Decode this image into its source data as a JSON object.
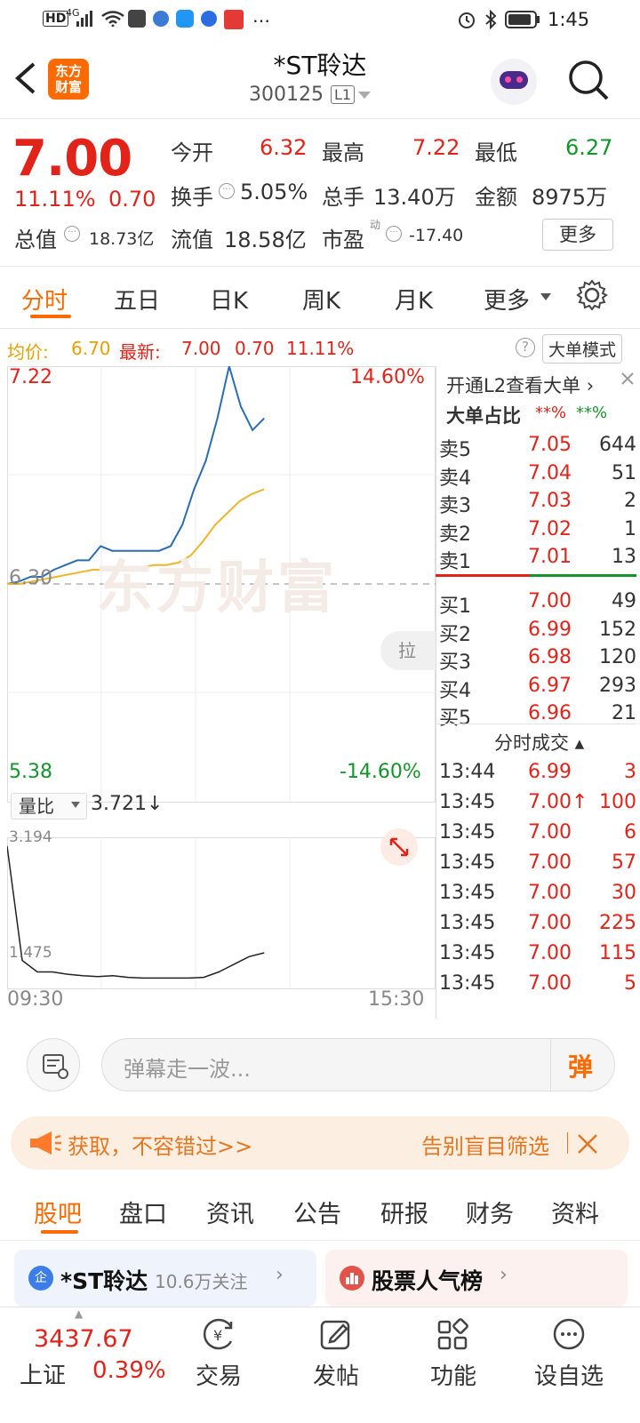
{
  "status": {
    "time": "1:45",
    "net": "4G"
  },
  "header": {
    "logo": "东方\n财富",
    "title": "*ST聆达",
    "code": "300125",
    "level": "L1"
  },
  "quote": {
    "price": "7.00",
    "pct": "11.11%",
    "chg": "0.70",
    "open_label": "今开",
    "open": "6.32",
    "high_label": "最高",
    "high": "7.22",
    "low_label": "最低",
    "low": "6.27",
    "turnover_label": "换手",
    "turnover": "5.05%",
    "vol_label": "总手",
    "vol": "13.40万",
    "amount_label": "金额",
    "amount": "8975万",
    "mcap_label": "总值",
    "mcap": "18.73亿",
    "float_label": "流值",
    "float": "18.58亿",
    "pe_label": "市盈",
    "pe_sup": "动",
    "pe": "-17.40",
    "more_btn": "更多"
  },
  "tabs": [
    "分时",
    "五日",
    "日K",
    "周K",
    "月K",
    "更多"
  ],
  "infobar": {
    "avg_label": "均价:",
    "avg": "6.70",
    "latest_label": "最新:",
    "latest": "7.00",
    "chg": "0.70",
    "pct": "11.11%",
    "mode_btn": "大单模式"
  },
  "chart": {
    "y_top": "7.22",
    "y_top_pct": "14.60%",
    "y_mid": "6.30",
    "y_bottom": "5.38",
    "y_bottom_pct": "-14.60%",
    "pull_label": "拉",
    "watermark": "东方财富",
    "vr_label": "量比",
    "vr_value": "3.721↓",
    "vr_top": "3.194",
    "vr_bottom": "1.475",
    "time_start": "09:30",
    "time_end": "15:30"
  },
  "chart_data": {
    "type": "line",
    "x_range": [
      "09:30",
      "15:30"
    ],
    "ylim": [
      5.38,
      7.22
    ],
    "series": [
      {
        "values": [
          6.3,
          6.31,
          6.33,
          6.33,
          6.36,
          6.38,
          6.4,
          6.4,
          6.46,
          6.44,
          6.44,
          6.44,
          6.44,
          6.44,
          6.46,
          6.55,
          6.7,
          6.82,
          7.0,
          7.22,
          7.05,
          6.95,
          7.0
        ]
      },
      {
        "values": [
          6.3,
          6.3,
          6.31,
          6.32,
          6.33,
          6.34,
          6.35,
          6.36,
          6.36,
          6.37,
          6.37,
          6.37,
          6.38,
          6.38,
          6.39,
          6.42,
          6.48,
          6.55,
          6.6,
          6.65,
          6.68,
          6.7
        ]
      }
    ],
    "volume_ratio": {
      "ylim": [
        1.475,
        3.194
      ],
      "values": [
        3.194,
        1.7,
        1.55,
        1.55,
        1.52,
        1.5,
        1.49,
        1.5,
        1.48,
        1.47,
        1.47,
        1.47,
        1.47,
        1.48,
        1.55,
        1.65,
        1.75,
        1.8
      ]
    }
  },
  "book": {
    "l2_link": "开通L2查看大单",
    "ratio_label": "大单占比",
    "ratio_buy": "**%",
    "ratio_sell": "**%",
    "asks": [
      {
        "label": "卖5",
        "price": "7.05",
        "vol": "644"
      },
      {
        "label": "卖4",
        "price": "7.04",
        "vol": "51"
      },
      {
        "label": "卖3",
        "price": "7.03",
        "vol": "2"
      },
      {
        "label": "卖2",
        "price": "7.02",
        "vol": "1"
      },
      {
        "label": "卖1",
        "price": "7.01",
        "vol": "13"
      }
    ],
    "bids": [
      {
        "label": "买1",
        "price": "7.00",
        "vol": "49"
      },
      {
        "label": "买2",
        "price": "6.99",
        "vol": "152"
      },
      {
        "label": "买3",
        "price": "6.98",
        "vol": "120"
      },
      {
        "label": "买4",
        "price": "6.97",
        "vol": "293"
      },
      {
        "label": "买5",
        "price": "6.96",
        "vol": "21"
      }
    ],
    "trades_title": "分时成交",
    "trades": [
      {
        "time": "13:44",
        "price": "6.99",
        "vol": "3"
      },
      {
        "time": "13:45",
        "price": "7.00↑",
        "vol": "100"
      },
      {
        "time": "13:45",
        "price": "7.00",
        "vol": "6"
      },
      {
        "time": "13:45",
        "price": "7.00",
        "vol": "57"
      },
      {
        "time": "13:45",
        "price": "7.00",
        "vol": "30"
      },
      {
        "time": "13:45",
        "price": "7.00",
        "vol": "225"
      },
      {
        "time": "13:45",
        "price": "7.00",
        "vol": "115"
      },
      {
        "time": "13:45",
        "price": "7.00",
        "vol": "5"
      }
    ]
  },
  "inputbar": {
    "placeholder": "弹幕走一波...",
    "danmu_btn": "弹"
  },
  "banner": {
    "left": "获取，不容错过>>",
    "right": "告别盲目筛选"
  },
  "subtabs": [
    "股吧",
    "盘口",
    "资讯",
    "公告",
    "研报",
    "财务",
    "资料"
  ],
  "cards": {
    "left_title": "*ST聆达",
    "left_sub": "10.6万关注",
    "left_badge": "企",
    "right_title": "股票人气榜"
  },
  "bottomnav": {
    "index_value": "3437.67",
    "index_name": "上证",
    "index_pct": "0.39%",
    "items": [
      "交易",
      "发帖",
      "功能",
      "设自选"
    ]
  },
  "colors": {
    "up": "#e2231a",
    "down": "#14952c",
    "price_line": "#2a6db5",
    "avg_line": "#f0b429",
    "brand": "#ff6a00"
  }
}
